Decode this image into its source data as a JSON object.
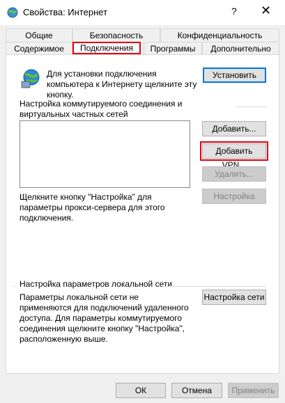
{
  "window": {
    "title": "Свойства: Интернет",
    "help": "?",
    "close": "✕"
  },
  "tabs": {
    "row1": [
      "Общие",
      "Безопасность",
      "Конфиденциальность"
    ],
    "row2": [
      "Содержимое",
      "Подключения",
      "Программы",
      "Дополнительно"
    ],
    "selected": "Подключения"
  },
  "setup": {
    "text": "Для установки подключения компьютера к Интернету щелкните эту кнопку.",
    "button": "Установить"
  },
  "dialup": {
    "label": "Настройка коммутируемого соединения и виртуальных частных сетей",
    "add": "Добавить...",
    "add_vpn": "Добавить VPN...",
    "remove": "Удалить...",
    "settings": "Настройка",
    "proxy_text": "Щелкните кнопку \"Настройка\" для параметры прокси-сервера для этого подключения."
  },
  "lan": {
    "label": "Настройка параметров локальной сети",
    "text": "Параметры локальной сети не применяются для подключений удаленного доступа. Для параметры коммутируемого соединения щелкните кнопку \"Настройка\", расположенную выше.",
    "button": "Настройка сети"
  },
  "footer": {
    "ok": "ОК",
    "cancel": "Отмена",
    "apply": "Применить"
  },
  "colors": {
    "highlight": "#e0000f",
    "accent": "#0078d7"
  }
}
